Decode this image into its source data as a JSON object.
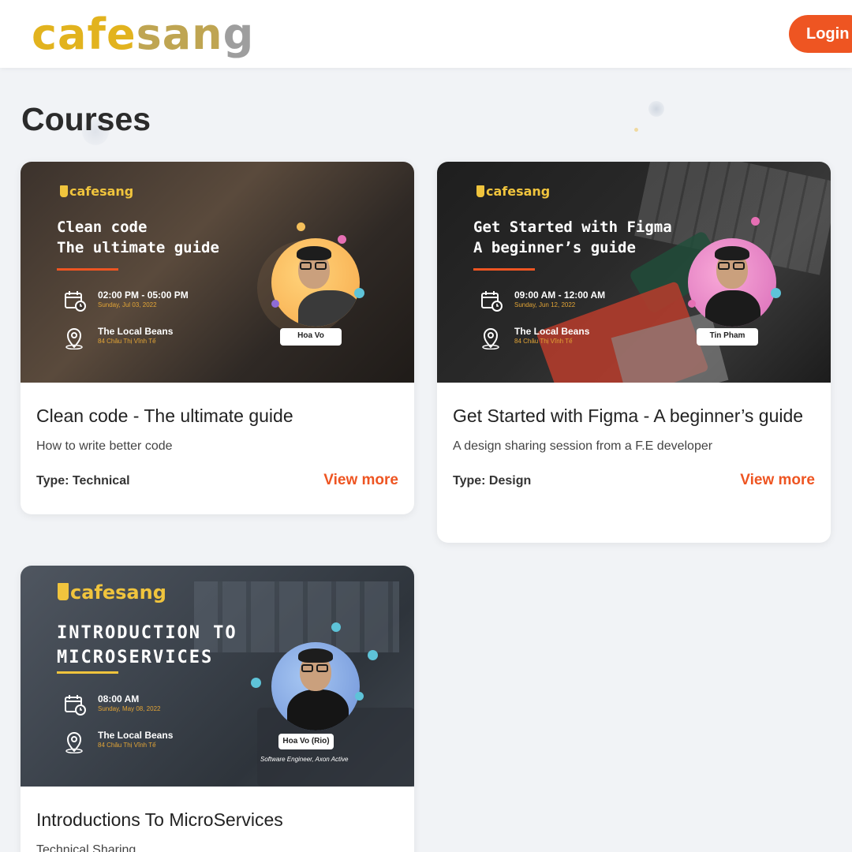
{
  "header": {
    "logo": {
      "part1": "cafe",
      "part2": "san",
      "part3": "g"
    },
    "login_label": "Login"
  },
  "page_title": "Courses",
  "colors": {
    "accent": "#ee5522",
    "logo_gold": "#e2b31e",
    "banner_gold": "#f0c43d"
  },
  "courses": [
    {
      "title": "Clean code - The ultimate guide",
      "description": "How to write better code",
      "type": "Type: Technical",
      "view_more": "View more",
      "banner": {
        "brand": "cafesang",
        "heading_line1": "Clean code",
        "heading_line2": "The ultimate guide",
        "time": "02:00 PM - 05:00 PM",
        "date": "Sunday, Jul 03, 2022",
        "venue": "The Local Beans",
        "address": "84 Châu Thị Vĩnh Tế",
        "speaker": "Hoa Vo",
        "calendar_icon": "calendar-clock-icon",
        "location_icon": "map-pin-icon"
      }
    },
    {
      "title": "Get Started with Figma - A beginner’s guide",
      "description": "A design sharing session from a F.E developer",
      "type": "Type: Design",
      "view_more": "View more",
      "banner": {
        "brand": "cafesang",
        "heading_line1": "Get Started with Figma",
        "heading_line2": "A beginner’s guide",
        "time": "09:00 AM - 12:00 AM",
        "date": "Sunday, Jun 12, 2022",
        "venue": "The Local Beans",
        "address": "84 Châu Thị Vĩnh Tế",
        "speaker": "Tin Pham",
        "calendar_icon": "calendar-clock-icon",
        "location_icon": "map-pin-icon"
      }
    },
    {
      "title": "Introductions To MicroServices",
      "description": "Technical Sharing",
      "banner": {
        "brand": "cafesang",
        "heading_line1": "INTRODUCTION TO",
        "heading_line2": "MICROSERVICES",
        "time": "08:00 AM",
        "date": "Sunday, May 08, 2022",
        "venue": "The Local Beans",
        "address": "84 Châu Thị Vĩnh Tế",
        "speaker": "Hoa Vo (Rio)",
        "speaker_role": "Software Engineer, Axon Active",
        "calendar_icon": "calendar-clock-icon",
        "location_icon": "map-pin-icon"
      }
    }
  ]
}
